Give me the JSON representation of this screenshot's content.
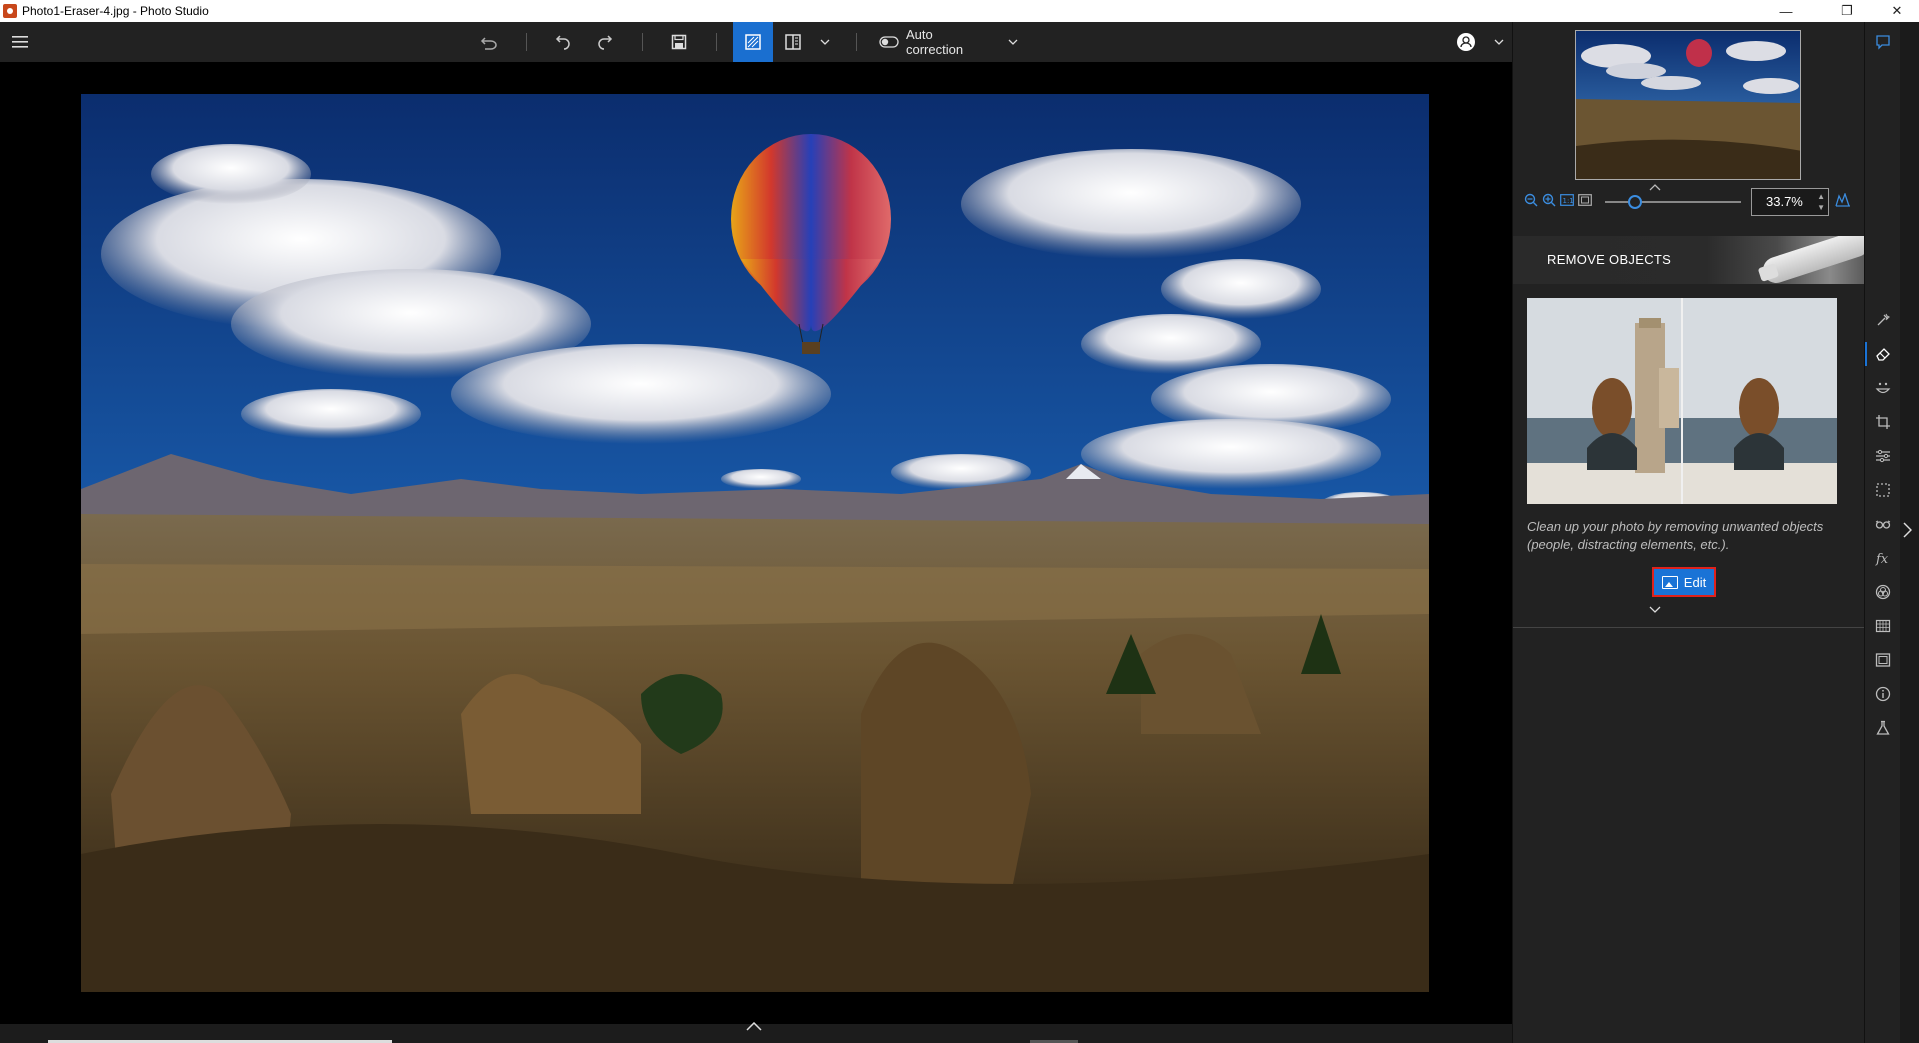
{
  "window": {
    "title": "Photo1-Eraser-4.jpg - Photo Studio",
    "controls": [
      "minimize",
      "restore",
      "close"
    ]
  },
  "toolbar": {
    "auto_correction_label": "Auto correction",
    "icons": [
      "menu-icon",
      "undo-all-icon",
      "undo-icon",
      "redo-icon",
      "save-icon",
      "single-view-icon",
      "compare-view-icon",
      "chevron-down-icon",
      "toggle-icon",
      "account-icon"
    ]
  },
  "navigator": {
    "zoom_value": "33.7%",
    "zoom_slider_fraction": 0.22
  },
  "remove_objects": {
    "title": "REMOVE OBJECTS",
    "description": "Clean up your photo by removing unwanted objects (people, distracting elements, etc.).",
    "edit_label": "Edit"
  },
  "rail": {
    "icons": [
      "auto-enhance-icon",
      "eraser-icon",
      "face-retouch-icon",
      "crop-icon",
      "adjust-icon",
      "selection-icon",
      "glasses-icon",
      "fx-icon",
      "color-wheel-icon",
      "texture-icon",
      "frame-icon",
      "info-icon",
      "lab-icon"
    ]
  },
  "colors": {
    "accent": "#1a73d6",
    "highlight_border": "#e0211b",
    "panel_bg": "#222222"
  }
}
